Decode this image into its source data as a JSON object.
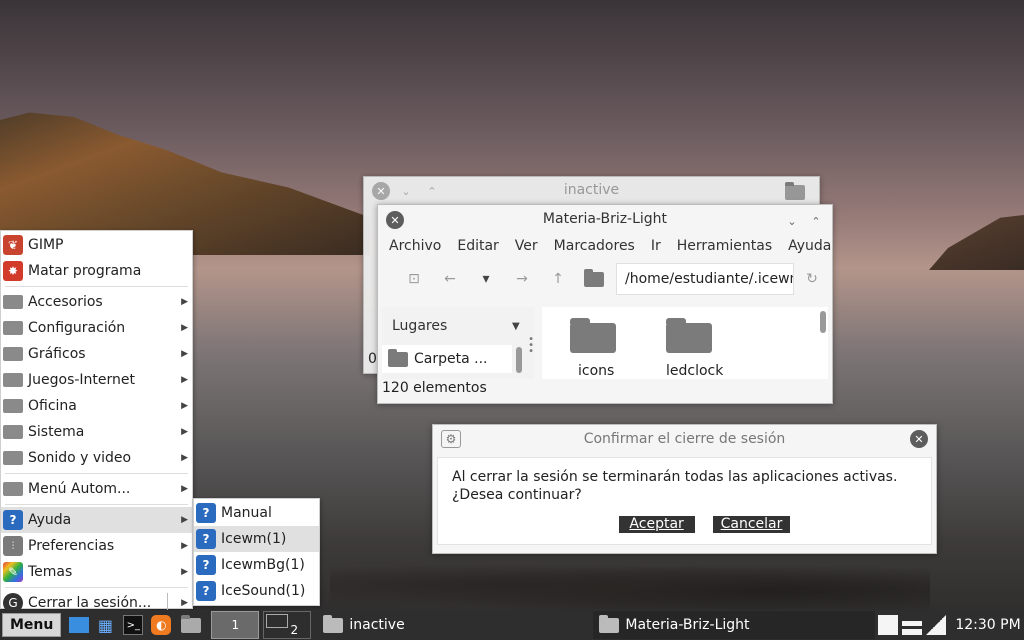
{
  "inactive_window": {
    "title": "inactive"
  },
  "file_manager": {
    "title": "Materia-Briz-Light",
    "menus": [
      "Archivo",
      "Editar",
      "Ver",
      "Marcadores",
      "Ir",
      "Herramientas",
      "Ayuda"
    ],
    "path": "/home/estudiante/.icewm",
    "sidebar_header": "Lugares",
    "sidebar_items": [
      "Carpeta ..."
    ],
    "files": [
      "icons",
      "ledclock"
    ],
    "status": "120 elementos",
    "back_partial": "0"
  },
  "dialog": {
    "title": "Confirmar el cierre de sesión",
    "message_line1": "Al cerrar la sesión se terminarán todas las aplicaciones activas.",
    "message_line2": "¿Desea continuar?",
    "accept": "Aceptar",
    "cancel": "Cancelar"
  },
  "start_menu": {
    "items": [
      {
        "label": "GIMP",
        "icon": "gimp-icon"
      },
      {
        "label": "Matar programa",
        "icon": "kill-icon"
      },
      {
        "label": "Accesorios",
        "icon": "folder-icon",
        "submenu": true
      },
      {
        "label": "Configuración",
        "icon": "folder-icon",
        "submenu": true
      },
      {
        "label": "Gráficos",
        "icon": "folder-icon",
        "submenu": true
      },
      {
        "label": "Juegos-Internet",
        "icon": "folder-icon",
        "submenu": true
      },
      {
        "label": "Oficina",
        "icon": "folder-icon",
        "submenu": true
      },
      {
        "label": "Sistema",
        "icon": "folder-icon",
        "submenu": true
      },
      {
        "label": "Sonido y video",
        "icon": "folder-icon",
        "submenu": true
      },
      {
        "label": "Menú Autom...",
        "icon": "folder-icon",
        "submenu": true
      },
      {
        "label": "Ayuda",
        "icon": "help-icon",
        "submenu": true
      },
      {
        "label": "Preferencias",
        "icon": "preferences-icon",
        "submenu": true
      },
      {
        "label": "Temas",
        "icon": "themes-icon",
        "submenu": true
      },
      {
        "label": "Cerrar la sesión...",
        "icon": "logout-icon",
        "submenu": true
      }
    ]
  },
  "help_submenu": {
    "items": [
      "Manual",
      "Icewm(1)",
      "IcewmBg(1)",
      "IceSound(1)"
    ]
  },
  "taskbar": {
    "menu_label": "Menu",
    "workspaces": [
      "1",
      "2"
    ],
    "tasks": [
      "inactive",
      "Materia-Briz-Light"
    ],
    "clock": "12:30 PM"
  }
}
